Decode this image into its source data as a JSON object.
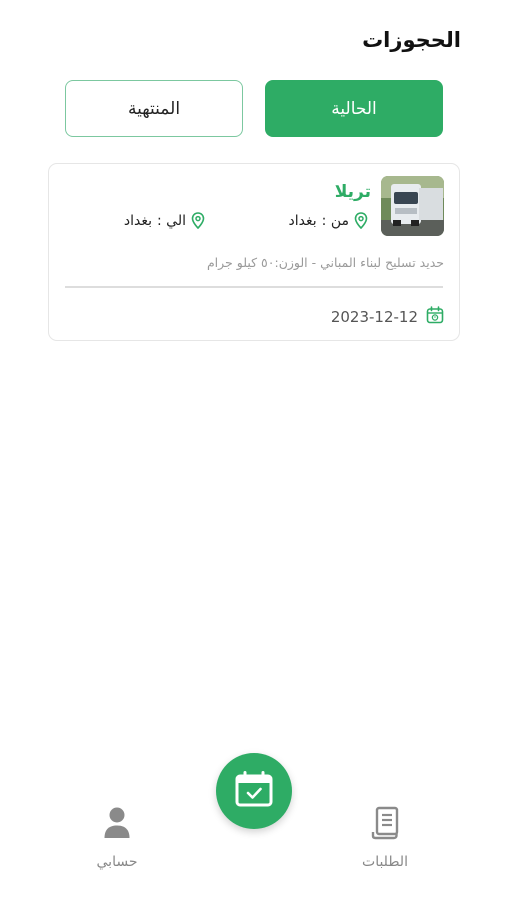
{
  "header": {
    "title": "الحجوزات"
  },
  "tabs": [
    {
      "label": "الحالية",
      "active": true
    },
    {
      "label": "المنتهية",
      "active": false
    }
  ],
  "booking": {
    "vehicle": "تريلا",
    "from_label": "من :",
    "from_city": "بغداد",
    "to_label": "الي :",
    "to_city": "بغداد",
    "description": "حديد تسليح لبناء المباني - الوزن:٥٠ كيلو جرام",
    "date": "2023-12-12",
    "icons": [
      "location-pin-icon",
      "calendar-icon",
      "truck-thumbnail"
    ]
  },
  "bottom_nav": {
    "orders_label": "الطلبات",
    "account_label": "حسابي",
    "icons": [
      "receipt-icon",
      "calendar-check-icon",
      "user-icon"
    ]
  },
  "colors": {
    "primary": "#2eac65",
    "tab_border": "#7cc8a0",
    "muted_text": "#9a9a9a",
    "nav_text": "#888888"
  }
}
